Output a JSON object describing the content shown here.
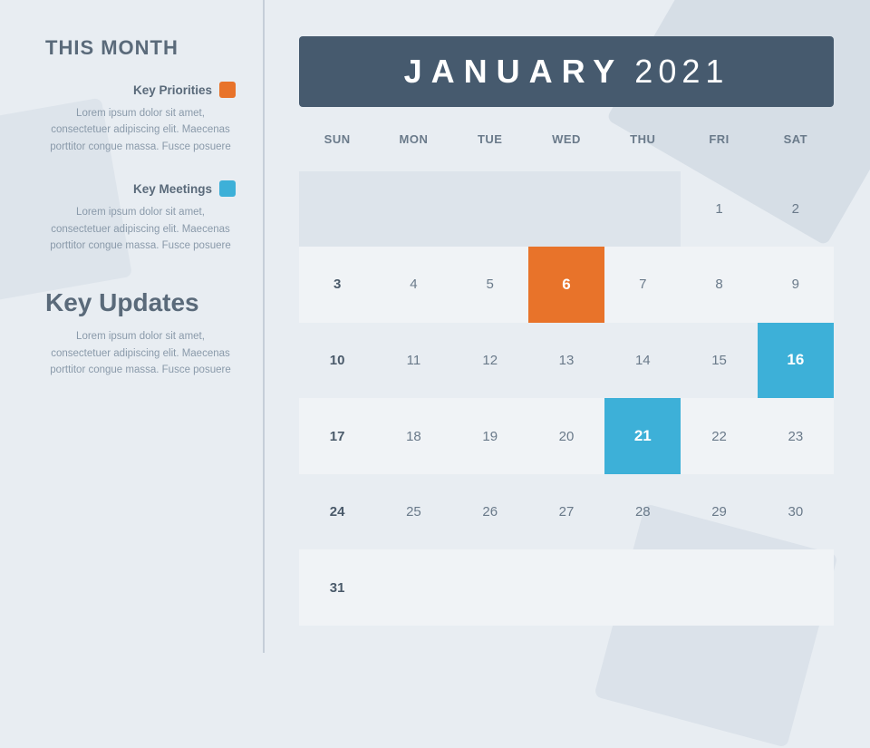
{
  "sidebar": {
    "title": "THIS MONTH",
    "key_priorities": {
      "label": "Key Priorities",
      "color": "orange",
      "body": "Lorem ipsum dolor sit amet, consectetuer adipiscing elit. Maecenas porttitor congue massa. Fusce posuere"
    },
    "key_meetings": {
      "label": "Key Meetings",
      "color": "blue",
      "body": "Lorem ipsum dolor sit amet, consectetuer adipiscing elit. Maecenas porttitor congue massa. Fusce posuere"
    },
    "key_updates": {
      "title": "Key Updates",
      "body": "Lorem ipsum dolor sit amet, consectetuer adipiscing elit. Maecenas porttitor congue massa. Fusce posuere"
    }
  },
  "calendar": {
    "month": "JANUARY",
    "year": "2021",
    "day_headers": [
      "SUN",
      "MON",
      "TUE",
      "WED",
      "THU",
      "FRI",
      "SAT"
    ],
    "highlighted_orange": [
      6
    ],
    "highlighted_blue": [
      16,
      21
    ],
    "days": [
      {
        "day": "",
        "empty": true
      },
      {
        "day": "",
        "empty": true
      },
      {
        "day": "",
        "empty": true
      },
      {
        "day": "",
        "empty": true
      },
      {
        "day": "",
        "empty": true
      },
      {
        "day": "1",
        "empty": false
      },
      {
        "day": "2",
        "empty": false
      },
      {
        "day": "3",
        "sunday": true,
        "empty": false
      },
      {
        "day": "4",
        "empty": false
      },
      {
        "day": "5",
        "empty": false
      },
      {
        "day": "6",
        "highlight": "orange",
        "empty": false
      },
      {
        "day": "7",
        "empty": false
      },
      {
        "day": "8",
        "empty": false
      },
      {
        "day": "9",
        "empty": false
      },
      {
        "day": "10",
        "sunday": true,
        "empty": false
      },
      {
        "day": "11",
        "empty": false
      },
      {
        "day": "12",
        "empty": false
      },
      {
        "day": "13",
        "empty": false
      },
      {
        "day": "14",
        "empty": false
      },
      {
        "day": "15",
        "empty": false
      },
      {
        "day": "16",
        "highlight": "blue",
        "empty": false
      },
      {
        "day": "17",
        "sunday": true,
        "empty": false
      },
      {
        "day": "18",
        "empty": false
      },
      {
        "day": "19",
        "empty": false
      },
      {
        "day": "20",
        "empty": false
      },
      {
        "day": "21",
        "highlight": "blue",
        "empty": false
      },
      {
        "day": "22",
        "empty": false
      },
      {
        "day": "23",
        "empty": false
      },
      {
        "day": "24",
        "sunday": true,
        "empty": false
      },
      {
        "day": "25",
        "empty": false
      },
      {
        "day": "26",
        "empty": false
      },
      {
        "day": "27",
        "empty": false
      },
      {
        "day": "28",
        "empty": false
      },
      {
        "day": "29",
        "empty": false
      },
      {
        "day": "30",
        "empty": false
      },
      {
        "day": "31",
        "sunday": true,
        "empty": false
      },
      {
        "day": "",
        "empty": false
      },
      {
        "day": "",
        "empty": false
      },
      {
        "day": "",
        "empty": false
      },
      {
        "day": "",
        "empty": false
      },
      {
        "day": "",
        "empty": false
      },
      {
        "day": "",
        "empty": false
      }
    ]
  }
}
